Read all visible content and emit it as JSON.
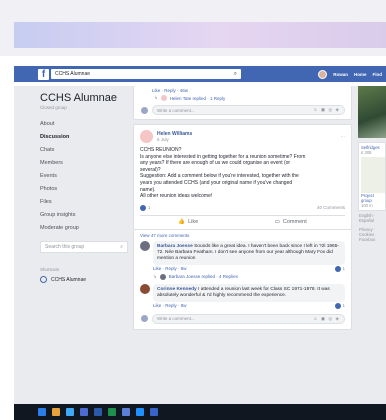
{
  "topbar": {
    "search_value": "CCHS Alumnae",
    "user_name": "Rowan",
    "home_label": "Home",
    "find_friends_label": "Find"
  },
  "sidebar": {
    "group_name": "CCHS Alumnae",
    "group_type": "Closed group",
    "items": [
      {
        "label": "About"
      },
      {
        "label": "Discussion"
      },
      {
        "label": "Chats"
      },
      {
        "label": "Members"
      },
      {
        "label": "Events"
      },
      {
        "label": "Photos"
      },
      {
        "label": "Files"
      },
      {
        "label": "Group insights"
      },
      {
        "label": "Moderate group"
      }
    ],
    "search_placeholder": "Search this group",
    "shortcuts_label": "Shortcuts",
    "shortcut_item": "CCHS Alumnae"
  },
  "feed": {
    "prev": {
      "actions": "Like · Reply · 46w",
      "reply_text": "Helen Tate replied · 1 Reply",
      "comment_placeholder": "Write a comment..."
    },
    "post": {
      "author": "Helen Williams",
      "date": "6 July",
      "lines": [
        "CCHS REUNION?",
        "Is anyone else interested in getting together for a reunion sometime? From",
        "any years? If there are enough of us we could organise an event (or",
        "several)?",
        "Suggestion: Add a comment below if you're interested, together with the",
        "years you attended CCHS (and your original name if you've changed",
        "name).",
        "All other reunion ideas welcome!"
      ],
      "reaction_count": "1",
      "comment_count": "40 Comments",
      "like_label": "Like",
      "comment_label": "Comment"
    },
    "view_more": "View 47 more comments",
    "comments": [
      {
        "name": "Barbara Joesse",
        "text": "Sounds like a great idea. I haven't been back since I left in ?2l 1965-72. Née Barbara Featham. I don't see anyone from our year although Mary Fox did mention a reunion",
        "actions": "Like · Reply · 8w",
        "reply_text": "Barbara Joesse replied · 4 Replies",
        "reactions": "1"
      },
      {
        "name": "Corinne Kennedy",
        "text": "I attended a reunion last week for Class SC 1971-1978. It was absolutely wonderful & I'd highly recommend the experience.",
        "actions": "Like · Reply · 8w",
        "reactions": "1"
      }
    ],
    "comment_placeholder": "Write a comment..."
  },
  "right": {
    "card_title": "Selfridges",
    "card_sub": "£ 308",
    "card2_title": "Project group",
    "card2_sub": "100 m",
    "lang": "English · Español",
    "footer": "Privacy · Cookies · Faceboo"
  }
}
